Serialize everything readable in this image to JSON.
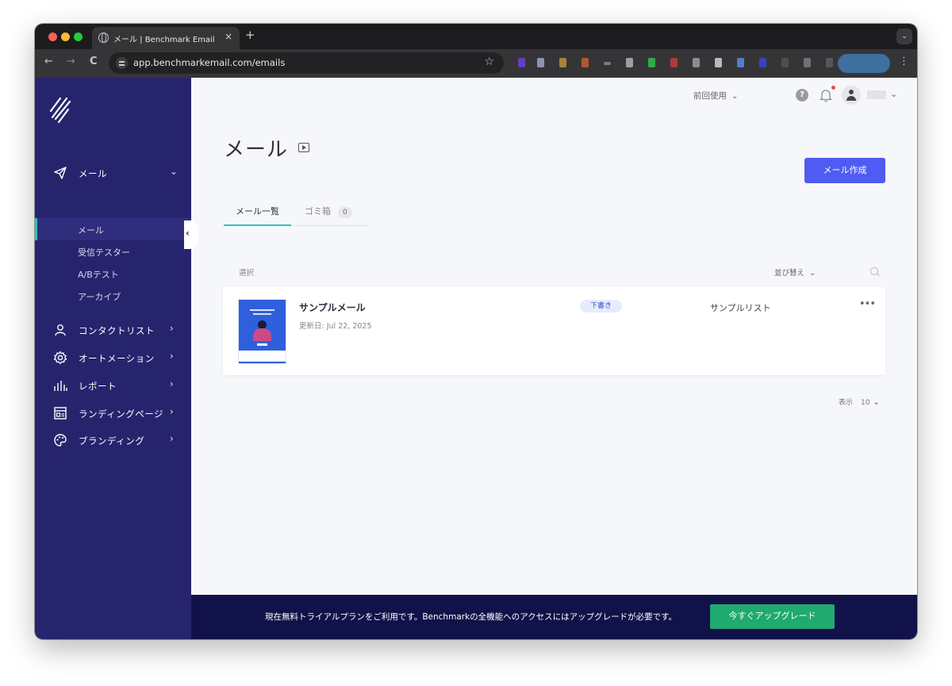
{
  "browser": {
    "tab_title": "メール | Benchmark Email",
    "tab_close": "×",
    "new_tab": "+",
    "menu_glyph": "⌄",
    "url": "app.benchmarkemail.com/emails",
    "nav": {
      "back": "←",
      "forward": "→",
      "reload": "C"
    },
    "star": "☆",
    "kebab": "⋮"
  },
  "sidebar": {
    "groups": [
      {
        "label": "メール",
        "icon": "paper-plane-icon",
        "chevron": "⌄"
      },
      {
        "label": "コンタクトリスト",
        "icon": "person-icon",
        "chevron": "›"
      },
      {
        "label": "オートメーション",
        "icon": "gear-icon",
        "chevron": "›"
      },
      {
        "label": "レポート",
        "icon": "bar-chart-icon",
        "chevron": "›"
      },
      {
        "label": "ランディングページ",
        "icon": "landing-page-icon",
        "chevron": "›"
      },
      {
        "label": "ブランディング",
        "icon": "palette-icon",
        "chevron": "›"
      }
    ],
    "subitems": [
      {
        "label": "メール",
        "active": true
      },
      {
        "label": "受信テスター",
        "active": false
      },
      {
        "label": "A/Bテスト",
        "active": false
      },
      {
        "label": "アーカイブ",
        "active": false
      }
    ],
    "collapse_glyph": "‹"
  },
  "header": {
    "recent_label": "前回使用",
    "chevron": "⌄",
    "help_glyph": "?"
  },
  "main": {
    "title": "メール",
    "create_button": "メール作成",
    "tabs": [
      {
        "label": "メール一覧",
        "active": true
      },
      {
        "label": "ゴミ箱",
        "count": "0",
        "active": false
      }
    ],
    "select_label": "選択",
    "sort_label": "並び替え",
    "emails": [
      {
        "name": "サンプルメール",
        "updated": "更新日: Jul 22, 2025",
        "status": "下書き",
        "list": "サンプルリスト",
        "more": "•••"
      }
    ],
    "page_size_label": "表示",
    "page_size": "10"
  },
  "banner": {
    "text": "現在無料トライアルプランをご利用です。Benchmarkの全機能へのアクセスにはアップグレードが必要です。",
    "button": "今すぐアップグレード"
  },
  "colors": {
    "sidebar_bg": "#27246e",
    "accent": "#2ec4b6",
    "primary_button": "#4f5bf2",
    "upgrade_button": "#1faa6f",
    "banner_bg": "#12124a"
  }
}
